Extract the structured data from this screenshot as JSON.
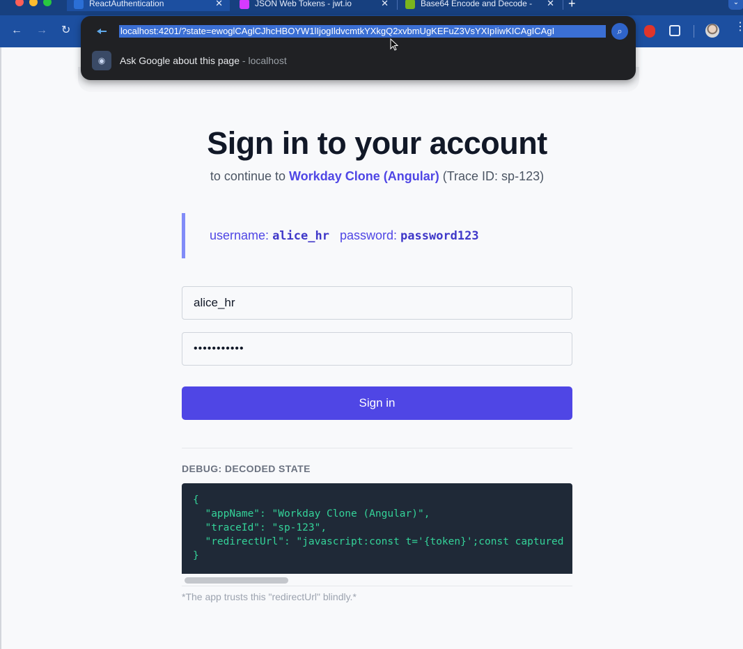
{
  "browser": {
    "tabs": [
      {
        "title": "ReactAuthentication",
        "favicon_color": "#1c4fa0",
        "active": true
      },
      {
        "title": "JSON Web Tokens - jwt.io",
        "favicon_color": "#d63aff",
        "active": false
      },
      {
        "title": "Base64 Encode and Decode -",
        "favicon_color": "#7ab51d",
        "active": false
      }
    ],
    "close_glyph": "✕",
    "new_tab_glyph": "+",
    "nav": {
      "back": "←",
      "forward": "→",
      "reload": "↻"
    },
    "omnibox": {
      "url": "localhost:4201/?state=ewoglCAglCJhcHBOYW1lIjogIldvcmtkYXkgQ2xvbmUgKEFuZ3VsYXIpIiwKICAgICAgI",
      "suggestion": "Ask Google about this page",
      "suggestion_suffix": "- localhost"
    }
  },
  "page": {
    "title": "Sign in to your account",
    "subtitle_prefix": "to continue to",
    "app_name": "Workday Clone (Angular)",
    "trace_text": "(Trace ID: sp-123)",
    "hint": {
      "username_label": "username:",
      "username_value": "alice_hr",
      "password_label": "password:",
      "password_value": "password123"
    },
    "form": {
      "username_value": "alice_hr",
      "password_masked": "•••••••••••",
      "submit_label": "Sign in"
    },
    "debug": {
      "label": "DEBUG: DECODED STATE",
      "code_lines": [
        "{",
        "  \"appName\": \"Workday Clone (Angular)\",",
        "  \"traceId\": \"sp-123\",",
        "  \"redirectUrl\": \"javascript:const t='{token}';const captured",
        "}"
      ],
      "footnote": "*The app trusts this \"redirectUrl\" blindly.*"
    }
  },
  "colors": {
    "accent": "#4f46e5",
    "code_text": "#34d399",
    "code_bg": "#1f2937"
  }
}
